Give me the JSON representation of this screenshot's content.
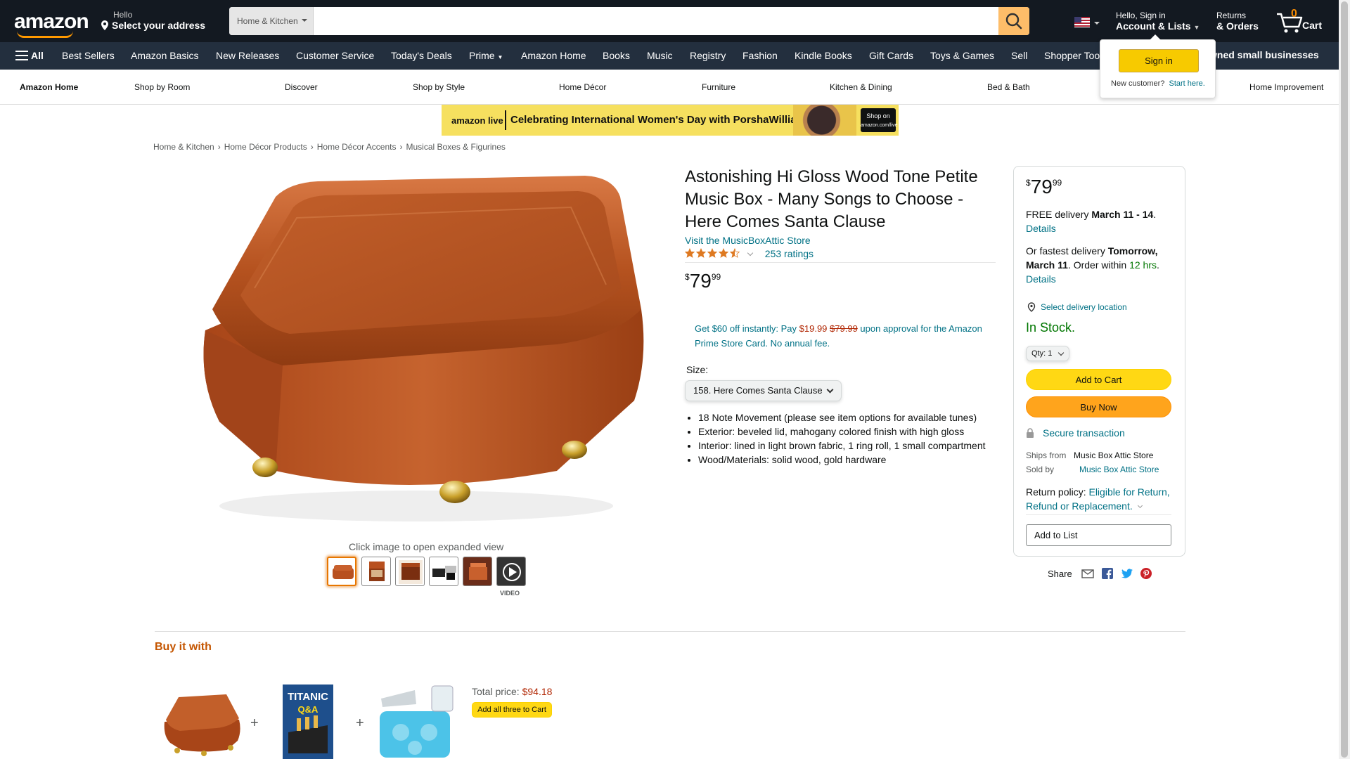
{
  "colors": {
    "nav_bg": "#131921",
    "subnav_bg": "#232f3e",
    "accent": "#ff9900",
    "link": "#007185",
    "price_red": "#b12704",
    "in_stock": "#007600",
    "add_to_cart": "#ffd814",
    "buy_now": "#ffa41c"
  },
  "header": {
    "logo": "amazon",
    "address_line1": "Hello",
    "address_line2": "Select your address",
    "search_category": "Home & Kitchen",
    "search_placeholder": "",
    "search_icon": "search-icon",
    "flag_icon": "us-flag-icon",
    "account_line1": "Hello, Sign in",
    "account_line2": "Account & Lists",
    "returns_line1": "Returns",
    "returns_line2": "& Orders",
    "cart_count": "0",
    "cart_label": "Cart"
  },
  "subnav": {
    "all_label": "All",
    "items": [
      "Best Sellers",
      "Amazon Basics",
      "New Releases",
      "Customer Service",
      "Today's Deals",
      "Prime",
      "Amazon Home",
      "Books",
      "Music",
      "Registry",
      "Fashion",
      "Kindle Books",
      "Gift Cards",
      "Toys & Games",
      "Sell",
      "Shopper Too"
    ],
    "promo": "wned small businesses"
  },
  "homenav": {
    "items": [
      "Amazon Home",
      "Shop by Room",
      "Discover",
      "Shop by Style",
      "Home Décor",
      "Furniture",
      "Kitchen & Dining",
      "Bed & Bath",
      "Home Improvement"
    ]
  },
  "signin_flyout": {
    "button": "Sign in",
    "new_customer": "New customer?",
    "start_here": "Start here."
  },
  "banner": {
    "brand": "amazon live",
    "message": "Celebrating International Women's Day with PorshaWilliams",
    "cta_line1": "Shop on",
    "cta_line2": "amazon.com/live"
  },
  "breadcrumb": [
    "Home & Kitchen",
    "Home Décor Products",
    "Home Décor Accents",
    "Musical Boxes & Figurines"
  ],
  "product": {
    "title": "Astonishing Hi Gloss Wood Tone Petite Music Box - Many Songs to Choose - Here Comes Santa Clause",
    "store_link": "Visit the MusicBoxAttic Store",
    "rating_value": 4.5,
    "ratings_count": "253 ratings",
    "price_symbol": "$",
    "price_whole": "79",
    "price_fraction": "99",
    "promo_text1": "Get $60 off instantly: Pay",
    "promo_new_price": "$19.99",
    "promo_old_price": "$79.99",
    "promo_text2": "upon approval for the Amazon Prime Store Card. No annual fee.",
    "size_label": "Size:",
    "size_selected": "158. Here Comes Santa Clause",
    "bullets": [
      "18 Note Movement (please see item options for available tunes)",
      "Exterior: beveled lid, mahogany colored finish with high gloss",
      "Interior: lined in light brown fabric, 1 ring roll, 1 small compartment",
      "Wood/Materials: solid wood, gold hardware"
    ],
    "image_caption": "Click image to open expanded view",
    "video_label": "VIDEO"
  },
  "buybox": {
    "price_symbol": "$",
    "price_whole": "79",
    "price_fraction": "99",
    "delivery_prefix": "FREE delivery",
    "delivery_date": "March 11 - 14",
    "details": "Details",
    "fastest_prefix": "Or fastest delivery",
    "fastest_date": "Tomorrow, March 11",
    "order_within": "Order within",
    "order_time": "12 hrs",
    "select_location": "Select delivery location",
    "stock": "In Stock.",
    "qty_label": "Qty:",
    "qty_value": "1",
    "add_to_cart": "Add to Cart",
    "buy_now": "Buy Now",
    "secure": "Secure transaction",
    "ships_from_key": "Ships from",
    "ships_from_val": "Music Box Attic Store",
    "sold_by_key": "Sold by",
    "sold_by_val": "Music Box Attic Store",
    "return_key": "Return policy:",
    "return_val": "Eligible for Return, Refund or Replacement.",
    "add_to_list": "Add to List",
    "share": "Share"
  },
  "buy_it_with": {
    "title": "Buy it with",
    "plus": "+",
    "total_label": "Total price:",
    "total_value": "$94.18",
    "add_all": "Add all three to Cart",
    "book_title": "TITANIC",
    "book_subtitle": "Q&A"
  }
}
